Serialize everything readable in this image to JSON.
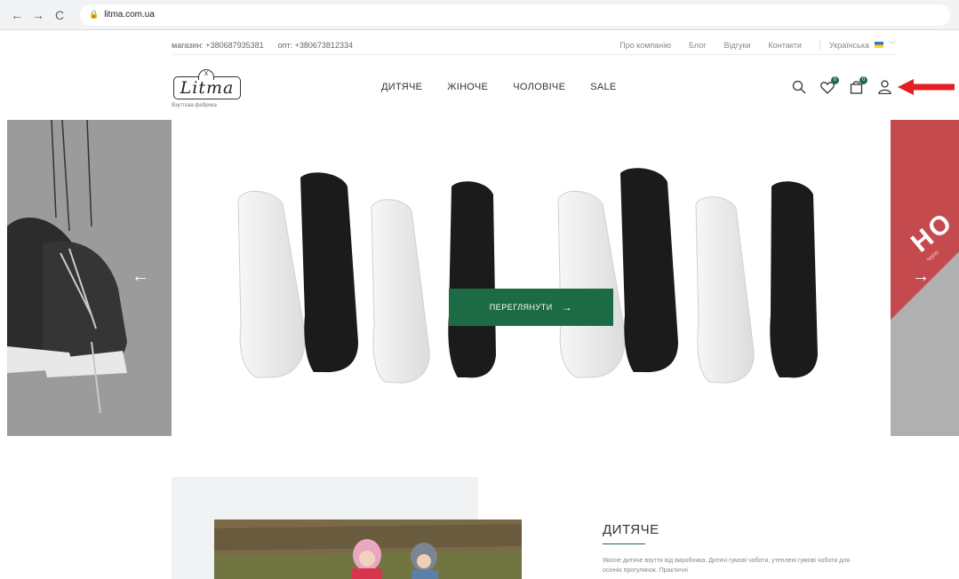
{
  "browser": {
    "url": "litma.com.ua",
    "back_icon": "arrow-left-icon",
    "forward_icon": "arrow-right-icon",
    "reload_icon": "reload-icon"
  },
  "topbar": {
    "shop_phone": "магазин: +380687935381",
    "wholesale_phone": "опт: +380673812334",
    "links": [
      "Про компанію",
      "Блог",
      "Відгуки",
      "Контакти"
    ],
    "language": "Українська"
  },
  "header": {
    "logo_text": "Litma",
    "logo_hat": "X",
    "logo_sub": "Взуттєва фабрика",
    "nav": [
      "ДИТЯЧЕ",
      "ЖІНОЧЕ",
      "ЧОЛОВІЧЕ",
      "SALE"
    ],
    "wishlist_count": "0",
    "cart_count": "0"
  },
  "hero": {
    "cta_label": "ПЕРЕГЛЯНУТИ",
    "cta_arrow": "→",
    "prev_arrow": "←",
    "next_arrow": "→",
    "right_slide_text": "НО",
    "right_slide_sub": "чоло"
  },
  "section": {
    "title": "ДИТЯЧЕ",
    "text": "Якісне дитяче взуття від виробника. Дитячі гумові чоботи, утеплені гумові чоботи для осінніх прогулянок. Практичні"
  },
  "colors": {
    "accent": "#1c6b45",
    "annotation": "#e31e24"
  }
}
